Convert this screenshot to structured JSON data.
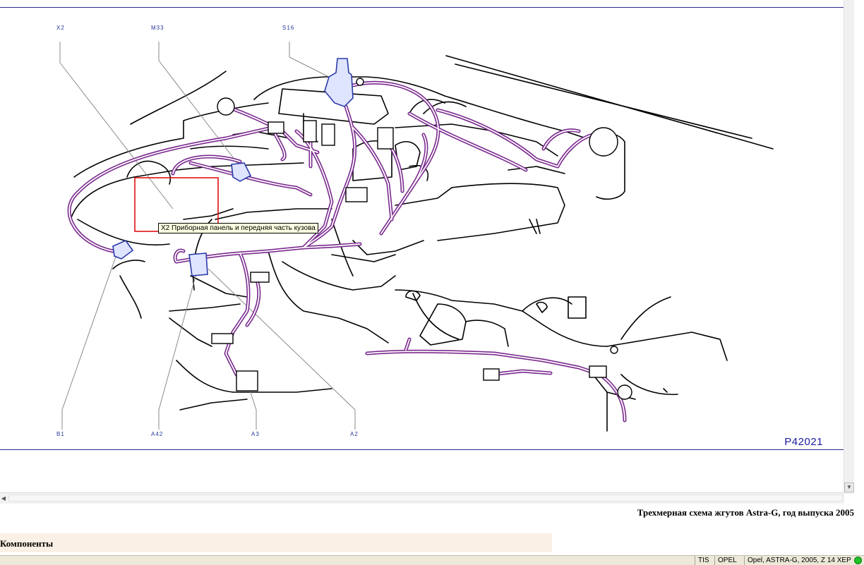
{
  "diagram": {
    "labels": {
      "x2": "X2",
      "m33": "M33",
      "s16": "S16",
      "b1": "B1",
      "a42": "A42",
      "a3": "A3",
      "a2": "A2"
    },
    "figure_id": "P42021",
    "tooltip": "X2 Приборная панель и передняя часть кузова",
    "colors": {
      "harness": "#7a2a8e",
      "connector": "#2a3aa8",
      "highlight": "#e01010",
      "line": "#000000"
    }
  },
  "caption": "Трехмерная схема жгутов Astra-G, год выпуска 2005",
  "components_title": "Компоненты",
  "statusbar": {
    "cell1": "TIS",
    "cell2": "OPEL",
    "cell3": "Opel, ASTRA-G, 2005, Z 14 XEP",
    "indicator_color": "#22c32a"
  }
}
